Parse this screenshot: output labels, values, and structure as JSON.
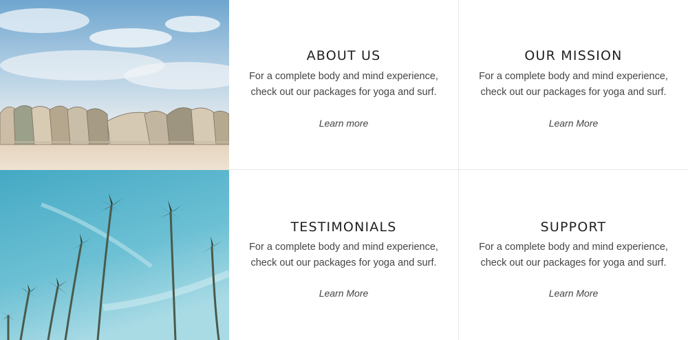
{
  "cards": [
    {
      "title": "ABOUT US",
      "line1": "For a complete body and mind experience,",
      "line2": "check out our packages for yoga and surf.",
      "link": "Learn more"
    },
    {
      "title": "OUR MISSION",
      "line1": "For a complete body and mind experience,",
      "line2": "check out our packages for yoga and surf.",
      "link": "Learn More"
    },
    {
      "title": "TESTIMONIALS",
      "line1": "For a complete body and mind experience,",
      "line2": "check out our packages for yoga and surf.",
      "link": "Learn More"
    },
    {
      "title": "SUPPORT",
      "line1": "For a complete body and mind experience,",
      "line2": "check out our packages for yoga and surf.",
      "link": "Learn More"
    }
  ],
  "colors": {
    "heading": "#1f1f1f",
    "body_text": "#444444",
    "divider": "#e6e6e6",
    "sky_top": "#6fa6cf",
    "sky_teal": "#4fb1c9",
    "sand": "#e8d8c3"
  },
  "images": [
    {
      "name": "pavilion-photo",
      "subject": "curved architecture structure on beach under cloudy sky"
    },
    {
      "name": "palm-trees-photo",
      "subject": "tall palm trees against blue sky"
    }
  ]
}
